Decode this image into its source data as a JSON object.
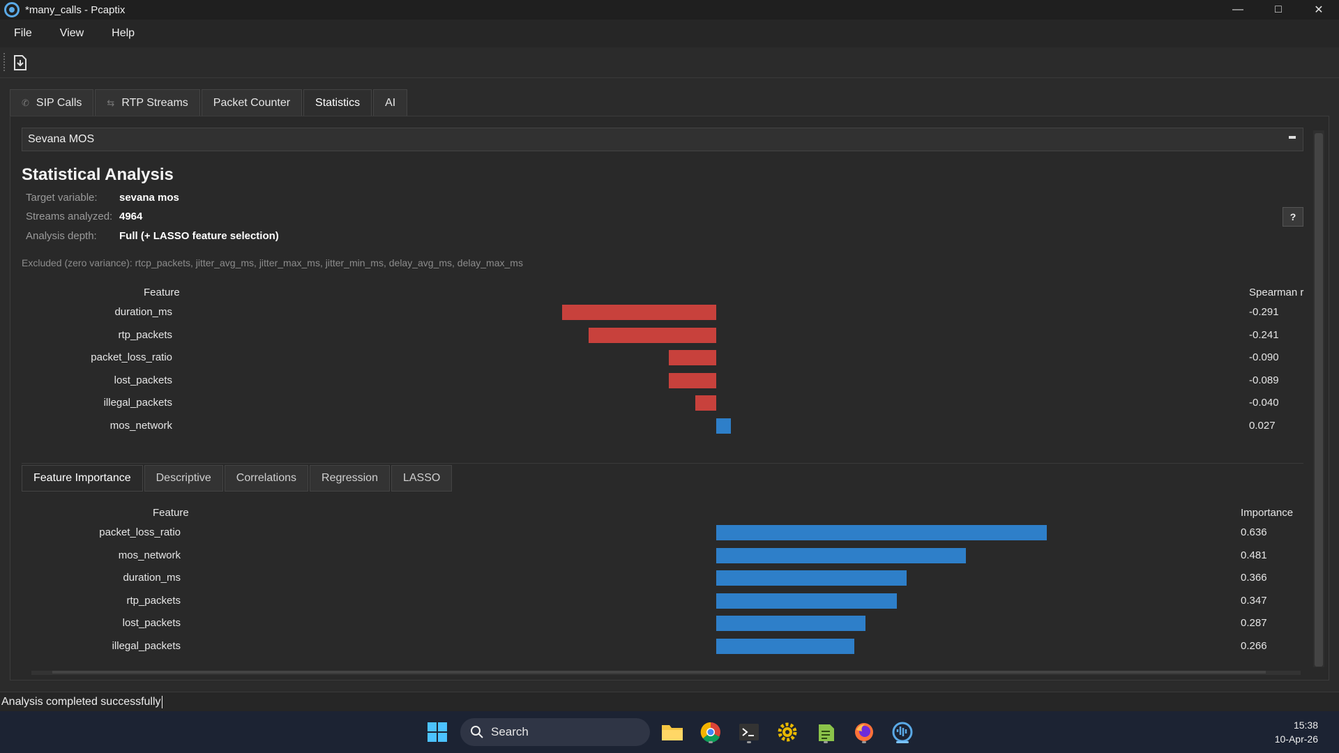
{
  "window": {
    "title": "*many_calls - Pcaptix"
  },
  "menu": [
    "File",
    "View",
    "Help"
  ],
  "top_tabs": [
    {
      "label": "SIP Calls",
      "icon": "phone-icon"
    },
    {
      "label": "RTP Streams",
      "icon": "stream-icon"
    },
    {
      "label": "Packet Counter"
    },
    {
      "label": "Statistics",
      "active": true
    },
    {
      "label": "AI"
    }
  ],
  "selector": {
    "value": "Sevana MOS"
  },
  "analysis": {
    "title": "Statistical Analysis",
    "target_label": "Target variable:",
    "target_value": "sevana mos",
    "streams_label": "Streams analyzed:",
    "streams_value": "4964",
    "depth_label": "Analysis depth:",
    "depth_value": "Full (+ LASSO feature selection)",
    "help": "?",
    "excluded": "Excluded (zero variance): rtcp_packets, jitter_avg_ms, jitter_max_ms, jitter_min_ms, delay_avg_ms, delay_max_ms"
  },
  "correlation_chart": {
    "feature_header": "Feature",
    "value_header": "Spearman r",
    "negative_color": "#c8413c",
    "positive_color": "#2e7fc9",
    "rows": [
      {
        "feature": "duration_ms",
        "label": "-0.291",
        "value": -0.291
      },
      {
        "feature": "rtp_packets",
        "label": "-0.241",
        "value": -0.241
      },
      {
        "feature": "packet_loss_ratio",
        "label": "-0.090",
        "value": -0.09
      },
      {
        "feature": "lost_packets",
        "label": "-0.089",
        "value": -0.089
      },
      {
        "feature": "illegal_packets",
        "label": "-0.040",
        "value": -0.04
      },
      {
        "feature": "mos_network",
        "label": "0.027",
        "value": 0.027
      }
    ]
  },
  "sub_tabs": [
    "Feature Importance",
    "Descriptive",
    "Correlations",
    "Regression",
    "LASSO"
  ],
  "importance_chart": {
    "feature_header": "Feature",
    "value_header": "Importance",
    "color": "#2e7fc9",
    "rows": [
      {
        "feature": "packet_loss_ratio",
        "label": "0.636",
        "value": 0.636
      },
      {
        "feature": "mos_network",
        "label": "0.481",
        "value": 0.481
      },
      {
        "feature": "duration_ms",
        "label": "0.366",
        "value": 0.366
      },
      {
        "feature": "rtp_packets",
        "label": "0.347",
        "value": 0.347
      },
      {
        "feature": "lost_packets",
        "label": "0.287",
        "value": 0.287
      },
      {
        "feature": "illegal_packets",
        "label": "0.266",
        "value": 0.266
      }
    ]
  },
  "status": {
    "text": "Analysis completed successfully"
  },
  "taskbar": {
    "search_placeholder": "Search",
    "time": "15:38",
    "date": "10-Apr-26"
  }
}
